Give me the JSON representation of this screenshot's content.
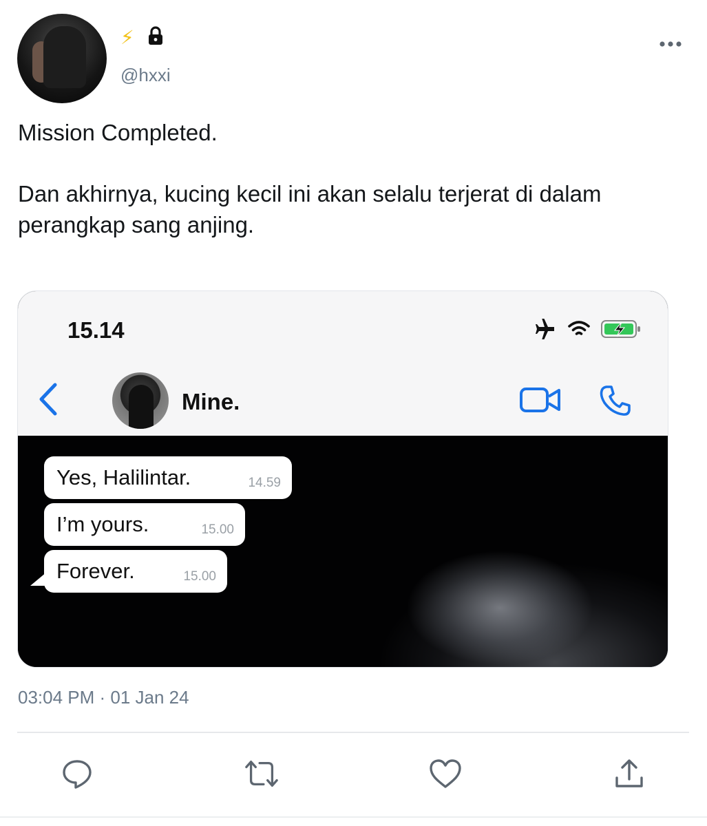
{
  "user": {
    "handle": "@hxxi",
    "badge_icons": [
      "lightning-icon",
      "lock-icon"
    ]
  },
  "more_icon": "more-icon",
  "tweet": {
    "line1": "Mission Completed.",
    "line2": "Dan akhirnya, kucing kecil ini akan selalu terjerat di dalam perangkap sang anjing.",
    "timestamp": "03:04 PM · 01 Jan 24"
  },
  "screenshot": {
    "status_time": "15.14",
    "status_icons": [
      "airplane-icon",
      "wifi-icon",
      "battery-charging-icon"
    ],
    "contact_name": "Mine.",
    "messages": [
      {
        "text": "Yes, Halilintar.",
        "time": "14.59"
      },
      {
        "text": "I’m yours.",
        "time": "15.00"
      },
      {
        "text": "Forever.",
        "time": "15.00"
      }
    ],
    "accent_color": "#1a73e8"
  },
  "actions": [
    "reply-icon",
    "retweet-icon",
    "like-icon",
    "share-icon"
  ]
}
